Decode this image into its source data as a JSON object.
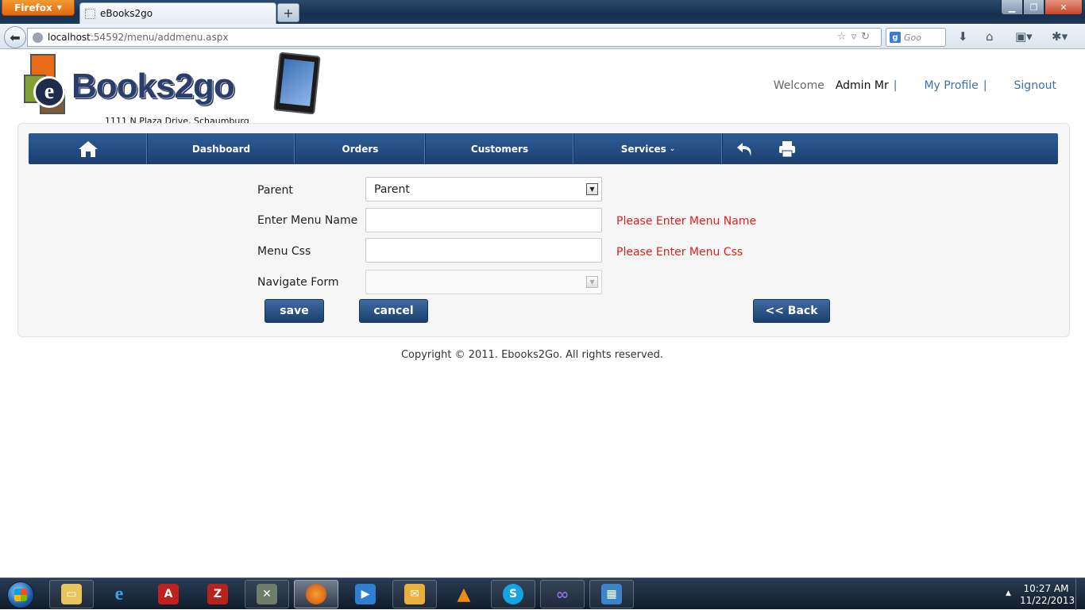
{
  "browser": {
    "app_button": "Firefox",
    "tab_title": "eBooks2go",
    "url_host": "localhost",
    "url_path": ":54592/menu/addmenu.aspx",
    "search_placeholder": "Goo"
  },
  "header": {
    "logo_text": "eBooks2go",
    "address": "1111 N Plaza Drive, Schaumburg",
    "welcome_label": "Welcome",
    "user_name": "Admin Mr",
    "my_profile": "My Profile",
    "signout": "Signout",
    "separator": "|"
  },
  "menu": {
    "dashboard": "Dashboard",
    "orders": "Orders",
    "customers": "Customers",
    "services": "Services"
  },
  "form": {
    "parent_label": "Parent",
    "parent_value": "Parent",
    "menu_name_label": "Enter Menu Name",
    "menu_name_value": "",
    "menu_name_error": "Please Enter Menu Name",
    "menu_css_label": "Menu Css",
    "menu_css_value": "",
    "menu_css_error": "Please Enter Menu Css",
    "navigate_form_label": "Navigate Form",
    "navigate_form_value": "",
    "save": "save",
    "cancel": "cancel",
    "back": "<< Back"
  },
  "footer": {
    "copyright": "Copyright © 2011. Ebooks2Go. All rights reserved."
  },
  "taskbar": {
    "time": "10:27 AM",
    "date": "11/22/2013"
  },
  "colors": {
    "menu_bar": "#1f4676",
    "error": "#e0201c",
    "link": "#3c6fb0",
    "button": "#2a4f82"
  }
}
